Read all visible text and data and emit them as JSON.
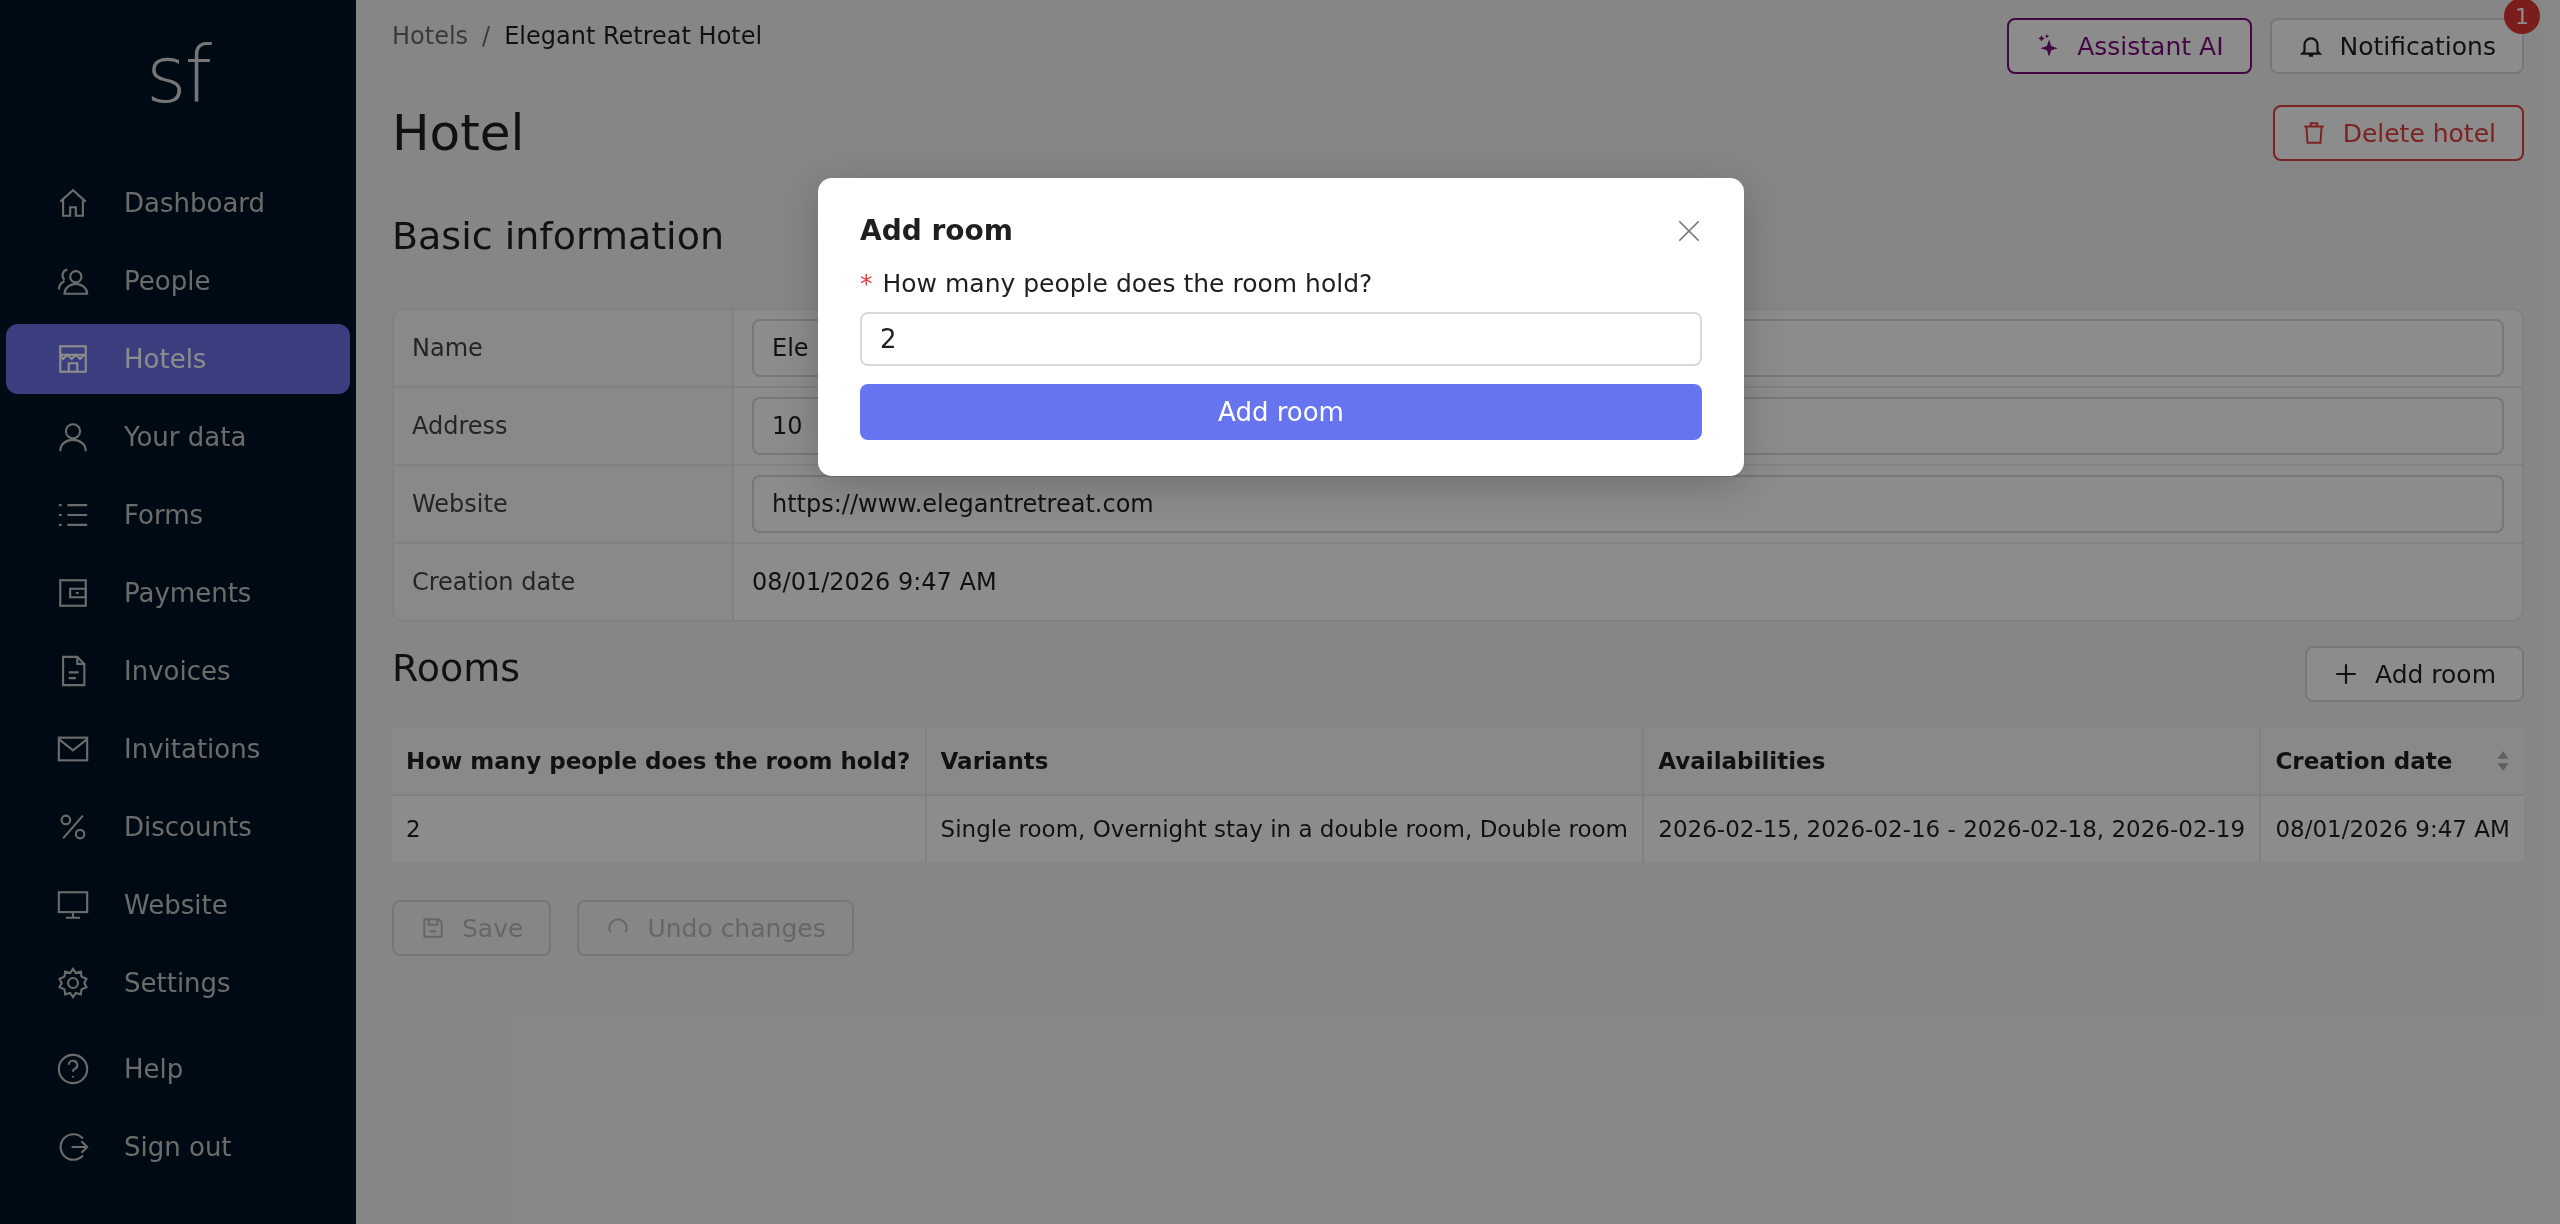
{
  "sidebar": {
    "logo": "sf",
    "items": [
      {
        "label": "Dashboard",
        "selected": false
      },
      {
        "label": "People",
        "selected": false
      },
      {
        "label": "Hotels",
        "selected": true
      },
      {
        "label": "Your data",
        "selected": false
      },
      {
        "label": "Forms",
        "selected": false
      },
      {
        "label": "Payments",
        "selected": false
      },
      {
        "label": "Invoices",
        "selected": false
      },
      {
        "label": "Invitations",
        "selected": false
      },
      {
        "label": "Discounts",
        "selected": false
      },
      {
        "label": "Website",
        "selected": false
      },
      {
        "label": "Settings",
        "selected": false
      }
    ],
    "bottom_items": [
      {
        "label": "Help",
        "selected": false
      },
      {
        "label": "Sign out",
        "selected": false
      }
    ]
  },
  "breadcrumb": {
    "separator": "/",
    "items": [
      "Hotels",
      "Elegant Retreat Hotel"
    ]
  },
  "header": {
    "assistant": "Assistant AI",
    "notifications": "Notifications",
    "badge": "1"
  },
  "title": "Hotel",
  "delete_button": "Delete hotel",
  "basic_info": {
    "heading": "Basic information",
    "rows": [
      {
        "label": "Name",
        "kind": "input",
        "value": "Ele"
      },
      {
        "label": "Address",
        "kind": "input",
        "value": "10"
      },
      {
        "label": "Website",
        "kind": "input",
        "value": "https://www.elegantretreat.com"
      },
      {
        "label": "Creation date",
        "kind": "text",
        "value": "08/01/2026 9:47 AM"
      }
    ]
  },
  "rooms": {
    "heading": "Rooms",
    "add_button": "Add room",
    "columns": [
      "How many people does the room hold?",
      "Variants",
      "Availabilities",
      "Creation date"
    ],
    "rows": [
      [
        "2",
        "Single room, Overnight stay in a double room, Double room",
        "2026-02-15, 2026-02-16 - 2026-02-18, 2026-02-19",
        "08/01/2026 9:47 AM"
      ]
    ]
  },
  "actions": {
    "save": "Save",
    "undo": "Undo changes"
  },
  "modal": {
    "title": "Add room",
    "required_mark": "*",
    "label": "How many people does the room hold?",
    "value": "2",
    "submit": "Add room"
  }
}
